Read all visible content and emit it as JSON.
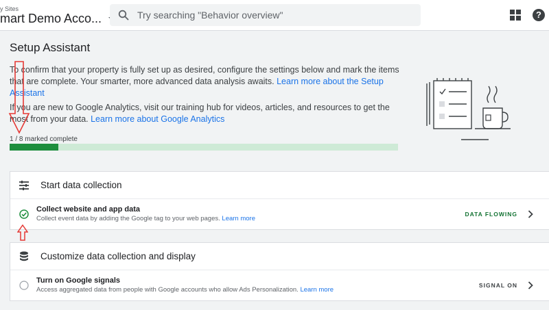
{
  "header": {
    "account_small": "y Sites",
    "account_name": "mart Demo Acco...",
    "search_placeholder": "Try searching \"Behavior overview\""
  },
  "setup": {
    "title": "Setup Assistant",
    "para1_text": "To confirm that your property is fully set up as desired, configure the settings below and mark the items that are complete. Your smarter, more advanced data analysis awaits. ",
    "para1_link": "Learn more about the Setup Assistant",
    "para2_text": "If you are new to Google Analytics, visit our training hub for videos, articles, and resources to get the most from your data. ",
    "para2_link": "Learn more about Google Analytics",
    "progress_label": "1 / 8 marked complete",
    "progress_fraction": 0.125
  },
  "sections": [
    {
      "title": "Start data collection",
      "rows": [
        {
          "title": "Collect website and app data",
          "desc": "Collect event data by adding the Google tag to your web pages. ",
          "link": "Learn more",
          "status_label": "DATA FLOWING",
          "status_color": "#137333",
          "done": true
        }
      ]
    },
    {
      "title": "Customize data collection and display",
      "rows": [
        {
          "title": "Turn on Google signals",
          "desc": "Access aggregated data from people with Google accounts who allow Ads Personalization. ",
          "link": "Learn more",
          "status_label": "SIGNAL ON",
          "status_color": "#3c4043",
          "done": false
        }
      ]
    }
  ],
  "colors": {
    "accent_link": "#1a73e8",
    "progress_fill": "#1e8e3e",
    "progress_track": "#ceead6",
    "annotation": "#e53935"
  }
}
